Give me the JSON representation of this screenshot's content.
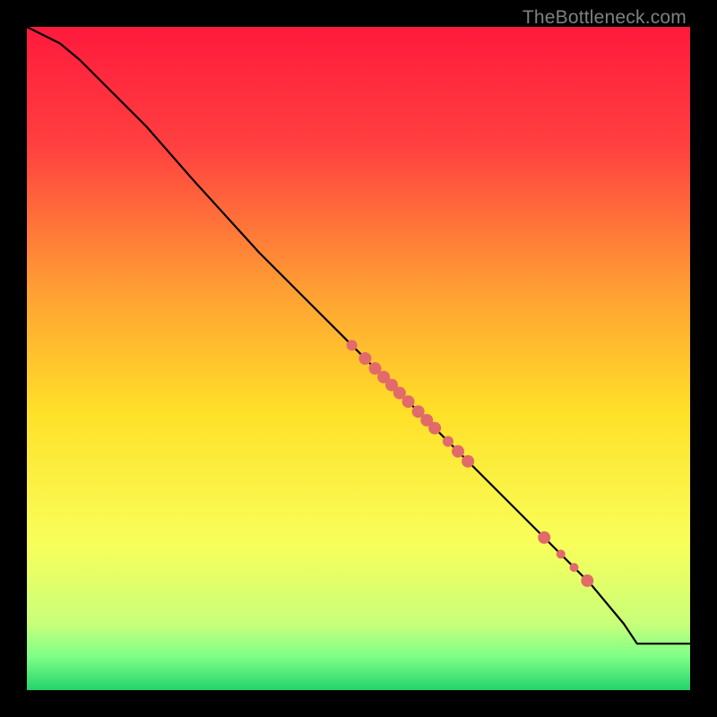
{
  "watermark": "TheBottleneck.com",
  "chart_data": {
    "type": "line",
    "title": "",
    "xlabel": "",
    "ylabel": "",
    "xlim": [
      0,
      100
    ],
    "ylim": [
      0,
      100
    ],
    "gradient_stops": [
      {
        "offset": 0,
        "color": "#ff1a3c"
      },
      {
        "offset": 18,
        "color": "#ff4040"
      },
      {
        "offset": 40,
        "color": "#ffa033"
      },
      {
        "offset": 58,
        "color": "#ffe028"
      },
      {
        "offset": 78,
        "color": "#f8ff5a"
      },
      {
        "offset": 90,
        "color": "#c8ff7a"
      },
      {
        "offset": 95,
        "color": "#7dff88"
      },
      {
        "offset": 100,
        "color": "#23d36a"
      }
    ],
    "series": [
      {
        "name": "curve",
        "x": [
          0,
          2,
          5,
          8,
          12,
          18,
          25,
          35,
          45,
          55,
          65,
          75,
          85,
          90,
          92,
          100
        ],
        "y": [
          100,
          99,
          97.5,
          95,
          91,
          85,
          77,
          66,
          56,
          46,
          36,
          26,
          16,
          10,
          7,
          7
        ],
        "stroke": "#000000",
        "stroke_width": 2.2
      }
    ],
    "points": {
      "color": "#e26a6a",
      "items": [
        {
          "x": 49.0,
          "y": 52.0,
          "r": 6
        },
        {
          "x": 51.0,
          "y": 50.0,
          "r": 7
        },
        {
          "x": 52.5,
          "y": 48.5,
          "r": 7
        },
        {
          "x": 53.8,
          "y": 47.2,
          "r": 7
        },
        {
          "x": 55.0,
          "y": 46.0,
          "r": 7
        },
        {
          "x": 56.2,
          "y": 44.8,
          "r": 7
        },
        {
          "x": 57.5,
          "y": 43.5,
          "r": 7
        },
        {
          "x": 59.0,
          "y": 42.0,
          "r": 7
        },
        {
          "x": 60.3,
          "y": 40.7,
          "r": 7
        },
        {
          "x": 61.5,
          "y": 39.5,
          "r": 7
        },
        {
          "x": 63.5,
          "y": 37.5,
          "r": 6
        },
        {
          "x": 65.0,
          "y": 36.0,
          "r": 7
        },
        {
          "x": 66.5,
          "y": 34.5,
          "r": 7
        },
        {
          "x": 78.0,
          "y": 23.0,
          "r": 7
        },
        {
          "x": 80.5,
          "y": 20.5,
          "r": 5
        },
        {
          "x": 82.5,
          "y": 18.5,
          "r": 5
        },
        {
          "x": 84.5,
          "y": 16.5,
          "r": 7
        }
      ]
    }
  }
}
